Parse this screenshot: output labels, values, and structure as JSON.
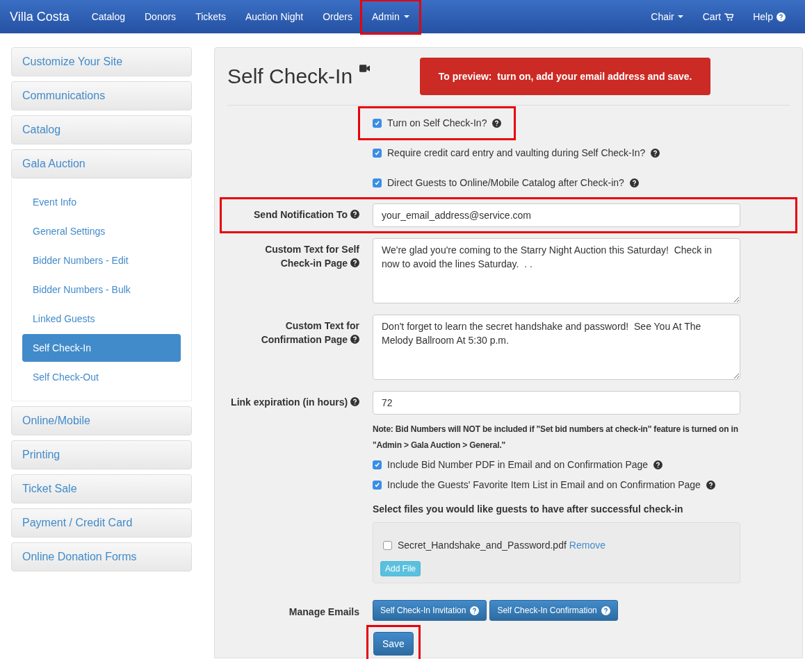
{
  "navbar": {
    "brand": "Villa Costa",
    "items": [
      {
        "label": "Catalog",
        "dropdown": false,
        "highlighted": false
      },
      {
        "label": "Donors",
        "dropdown": false,
        "highlighted": false
      },
      {
        "label": "Tickets",
        "dropdown": false,
        "highlighted": false
      },
      {
        "label": "Auction Night",
        "dropdown": false,
        "highlighted": false
      },
      {
        "label": "Orders",
        "dropdown": false,
        "highlighted": false
      },
      {
        "label": "Admin",
        "dropdown": true,
        "highlighted": true
      }
    ],
    "right_items": [
      {
        "label": "Chair",
        "kind": "dropdown"
      },
      {
        "label": "Cart",
        "kind": "cart"
      },
      {
        "label": "Help",
        "kind": "help"
      }
    ]
  },
  "sidebar": {
    "groups": [
      {
        "label": "Customize Your Site"
      },
      {
        "label": "Communications"
      },
      {
        "label": "Catalog"
      },
      {
        "label": "Gala Auction",
        "children": [
          {
            "label": "Event Info",
            "selected": false
          },
          {
            "label": "General Settings",
            "selected": false
          },
          {
            "label": "Bidder Numbers - Edit",
            "selected": false
          },
          {
            "label": "Bidder Numbers - Bulk",
            "selected": false
          },
          {
            "label": "Linked Guests",
            "selected": false
          },
          {
            "label": "Self Check-In",
            "selected": true
          },
          {
            "label": "Self Check-Out",
            "selected": false
          }
        ]
      },
      {
        "label": "Online/Mobile"
      },
      {
        "label": "Printing"
      },
      {
        "label": "Ticket Sale"
      },
      {
        "label": "Payment / Credit Card"
      },
      {
        "label": "Online Donation Forms"
      }
    ]
  },
  "page": {
    "title": "Self Check-In",
    "banner": "To preview:  turn on, add your email address and save.",
    "top_options": [
      {
        "label": "Turn on Self Check-In?",
        "checked": true,
        "highlighted": true
      },
      {
        "label": "Require credit card entry and vaulting during Self Check-In?",
        "checked": true,
        "highlighted": false
      },
      {
        "label": "Direct Guests to Online/Mobile Catalog after Check-in?",
        "checked": true,
        "highlighted": false
      }
    ],
    "fields": [
      {
        "kind": "input",
        "label": "Send Notification To",
        "value": "your_email_address@service.com",
        "highlighted": true
      },
      {
        "kind": "textarea",
        "label": "Custom Text for Self Check-in Page",
        "value": "We're glad you're coming to the Starry Night Auction this Saturday!  Check in now to avoid the lines Saturday.  . .",
        "highlighted": false
      },
      {
        "kind": "textarea",
        "label": "Custom Text for Confirmation Page",
        "value": "Don't forget to learn the secret handshake and password!  See You At The Melody Ballroom At 5:30 p.m.",
        "highlighted": false
      },
      {
        "kind": "input",
        "label": "Link expiration (in hours)",
        "value": "72",
        "highlighted": false
      }
    ],
    "note": "Note: Bid Numbers will NOT be included if \"Set bid numbers at check-in\" feature is turned on in \"Admin > Gala Auction > General.\"",
    "include_options": [
      {
        "label": "Include Bid Number PDF in Email and on Confirmation Page",
        "checked": true
      },
      {
        "label": "Include the Guests' Favorite Item List in Email and on Confirmation Page",
        "checked": true
      }
    ],
    "files_heading": "Select files you would like guests to have after successful check-in",
    "files": [
      {
        "name": "Secret_Handshake_and_Password.pdf",
        "checked": false,
        "remove_label": "Remove"
      }
    ],
    "add_file_button": "Add File",
    "manage_emails": {
      "label": "Manage Emails",
      "buttons": [
        "Self Check-In Invitation",
        "Self Check-In Confirmation"
      ]
    },
    "save_button": {
      "label": "Save",
      "highlighted": true
    }
  }
}
